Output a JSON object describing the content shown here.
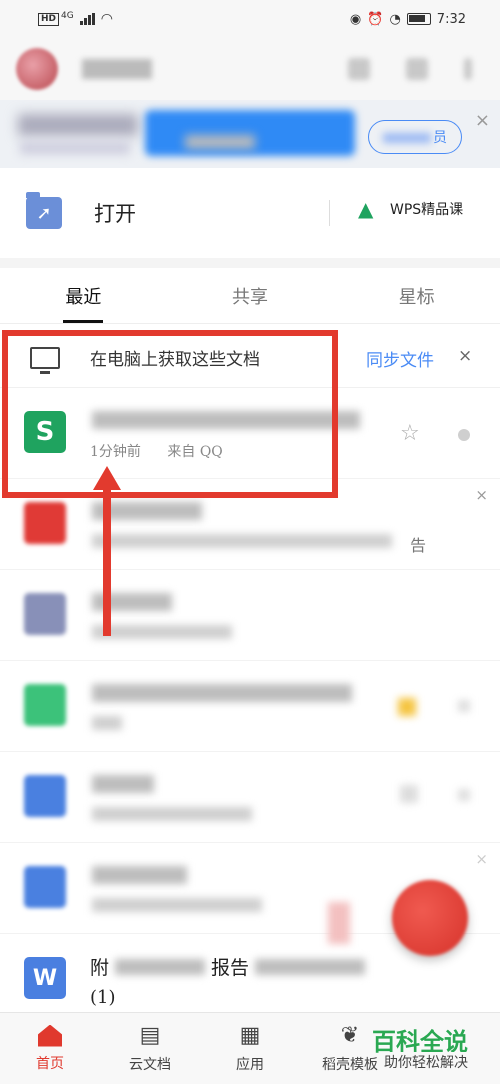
{
  "status_bar": {
    "network_badge": "HD",
    "network_type": "4G",
    "time": "7:32"
  },
  "open_section": {
    "open_label": "打开",
    "course_label": "WPS精品课"
  },
  "banner": {
    "vip_suffix": "员"
  },
  "tabs": [
    {
      "label": "最近"
    },
    {
      "label": "共享"
    },
    {
      "label": "星标"
    }
  ],
  "sync_prompt": {
    "text": "在电脑上获取这些文档",
    "action": "同步文件",
    "close": "×"
  },
  "files": [
    {
      "meta_time": "1分钟前",
      "meta_source": "来自 QQ",
      "icon_letter": "S"
    },
    {
      "ad_label": "告"
    },
    {
      "last_name_prefix": "附",
      "last_name_mid": "报告",
      "last_name_suffix": "(1)",
      "icon_letter": "W"
    }
  ],
  "bottom_nav": [
    {
      "label": "首页"
    },
    {
      "label": "云文档"
    },
    {
      "label": "应用"
    },
    {
      "label": "稻壳模板"
    }
  ],
  "watermark": {
    "title": "百科全说",
    "subtitle": "助你轻松解决"
  },
  "colors": {
    "accent_blue": "#4a8bf5",
    "accent_red": "#e0392e",
    "spreadsheet_green": "#1fa35f",
    "writer_blue": "#4a7fe0"
  }
}
